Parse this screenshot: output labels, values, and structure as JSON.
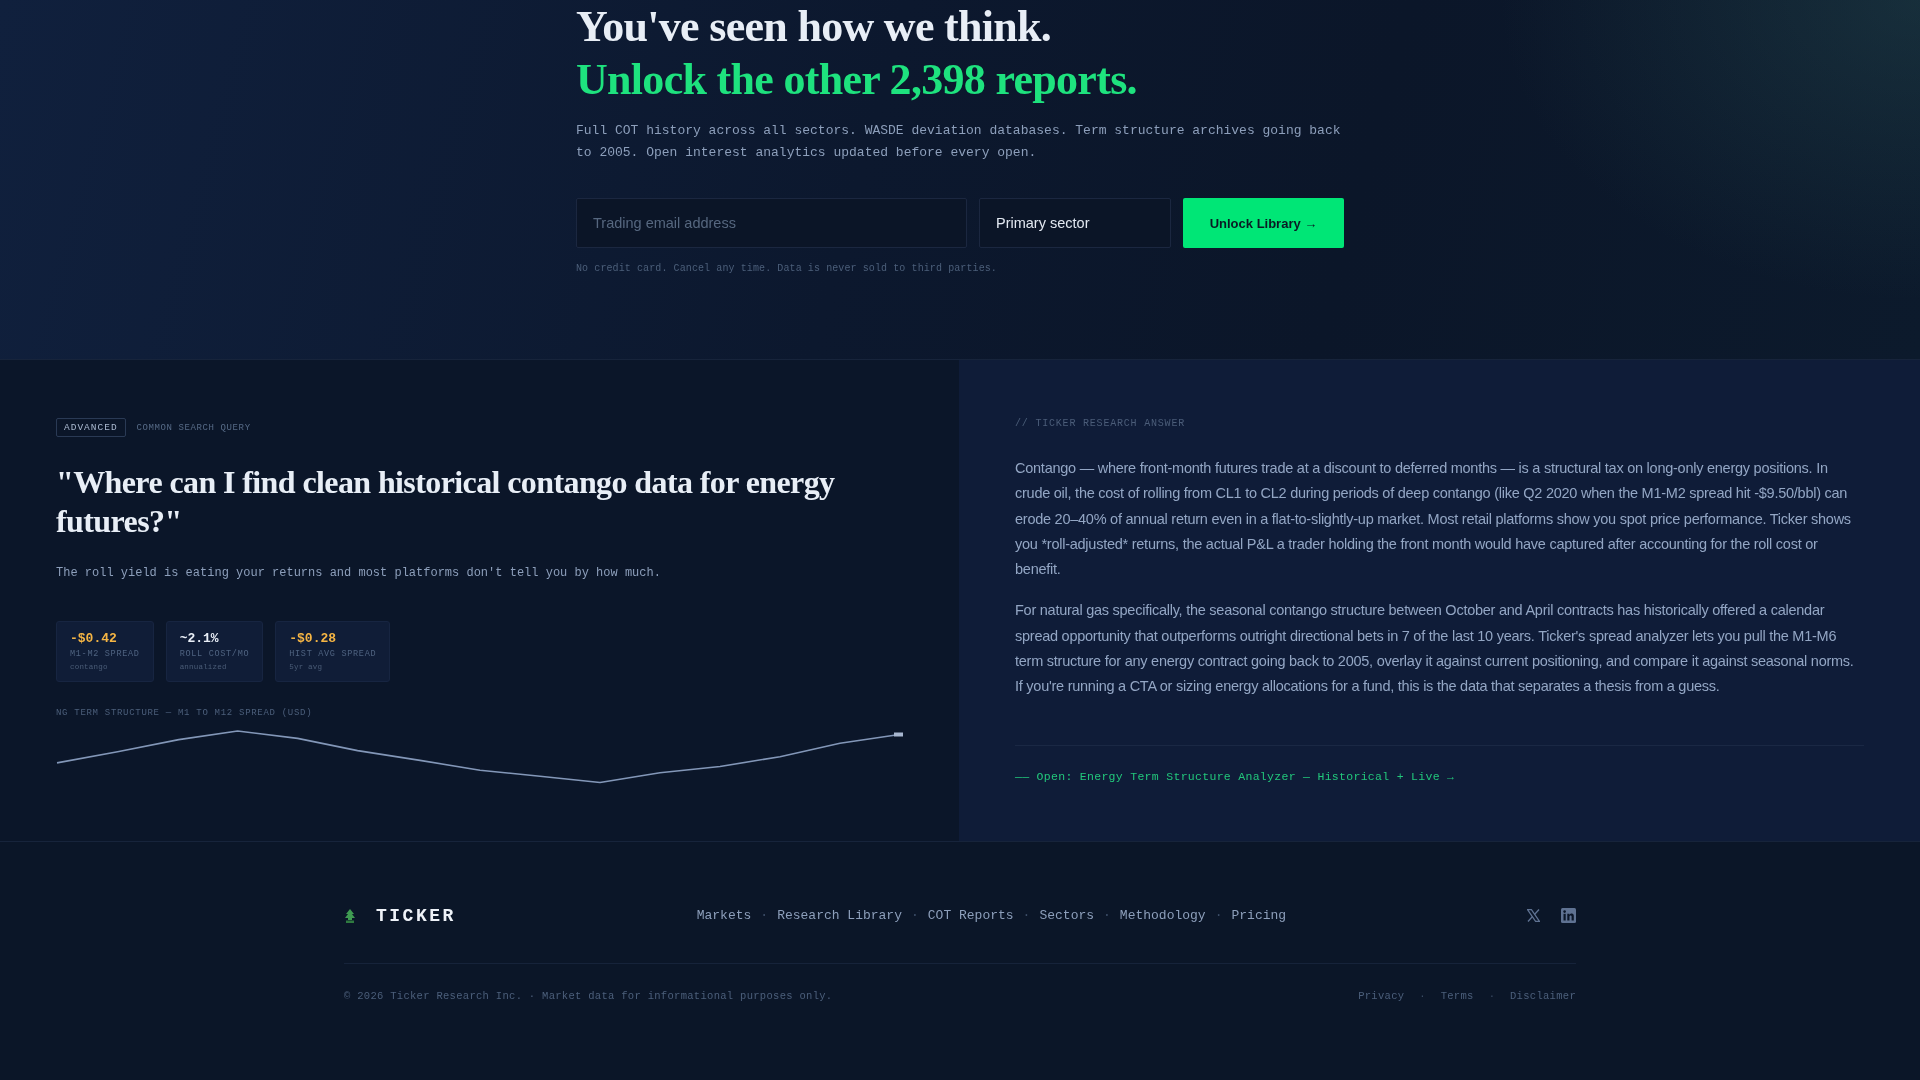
{
  "hero": {
    "title": "You've seen how we think.",
    "title_highlight": "Unlock the other 2,398 reports.",
    "description": "Full COT history across all sectors. WASDE deviation databases. Term structure archives going back to 2005. Open interest analytics updated before every open.",
    "email_field": {
      "placeholder": "Trading email address"
    },
    "sector_select": {
      "value": "Primary sector"
    },
    "submit_button": "Unlock Library →",
    "fine_print": "No credit card. Cancel any time. Data is never sold to third parties."
  },
  "query_panel": {
    "badge": "ADVANCED",
    "category": "COMMON SEARCH QUERY",
    "question": "\"Where can I find clean historical contango data for energy futures?\"",
    "subtitle": "The roll yield is eating your returns and most platforms don't tell you by how much.",
    "stats": [
      {
        "value": "-$0.42",
        "label": "M1-M2 SPREAD",
        "note": "contango",
        "color": "#f5b544"
      },
      {
        "value": "~2.1%",
        "label": "ROLL COST/MO",
        "note": "annualized",
        "color": "#e8eef6"
      },
      {
        "value": "-$0.28",
        "label": "HIST AVG SPREAD",
        "note": "5yr avg",
        "color": "#f5b544"
      }
    ],
    "chart_label": "NG TERM STRUCTURE — M1 TO M12 SPREAD (USD)"
  },
  "answer_panel": {
    "label": "// TICKER RESEARCH ANSWER",
    "paragraphs": [
      "Contango — where front-month futures trade at a discount to deferred months — is a structural tax on long-only energy positions. In crude oil, the cost of rolling from CL1 to CL2 during periods of deep contango (like Q2 2020 when the M1-M2 spread hit -$9.50/bbl) can erode 20–40% of annual return even in a flat-to-slightly-up market. Most retail platforms show you spot price performance. Ticker shows you *roll-adjusted* returns, the actual P&L a trader holding the front month would have captured after accounting for the roll cost or benefit.",
      "For natural gas specifically, the seasonal contango structure between October and April contracts has historically offered a calendar spread opportunity that outperforms outright directional bets in 7 of the last 10 years. Ticker's spread analyzer lets you pull the M1-M6 term structure for any energy contract going back to 2005, overlay it against current positioning, and compare it against seasonal norms. If you're running a CTA or sizing energy allocations for a fund, this is the data that separates a thesis from a guess."
    ],
    "link": "—— Open: Energy Term Structure Analyzer — Historical + Live →"
  },
  "footer": {
    "brand": "TICKER",
    "nav": [
      "Markets",
      "Research Library",
      "COT Reports",
      "Sectors",
      "Methodology",
      "Pricing"
    ],
    "separator": "·",
    "social": [
      {
        "kind": "x"
      },
      {
        "kind": "linkedin"
      }
    ],
    "copyright": "© 2026 Ticker Research Inc. · Market data for informational purposes only.",
    "legal_links": [
      "Privacy",
      "Terms",
      "Disclaimer"
    ],
    "legal_separator": "·"
  }
}
